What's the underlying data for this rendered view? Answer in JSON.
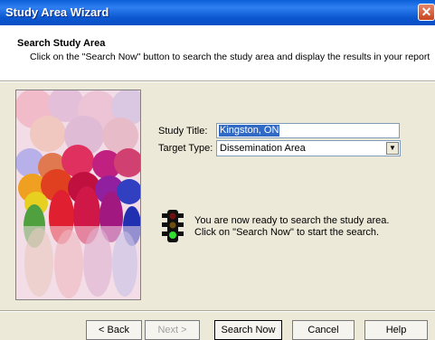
{
  "window": {
    "title": "Study Area Wizard",
    "close_glyph": "✕"
  },
  "header": {
    "title": "Search Study Area",
    "description": "Click on the \"Search Now\" button to search the study area and display the results in your report"
  },
  "form": {
    "study_title_label": "Study Title:",
    "study_title_value": "Kingston, ON",
    "target_type_label": "Target Type:",
    "target_type_value": "Dissemination Area"
  },
  "message": {
    "line1": "You are now ready to search the study area.",
    "line2": "Click on \"Search Now\" to start the search."
  },
  "buttons": {
    "back": "< Back",
    "next": "Next >",
    "search_now": "Search Now",
    "cancel": "Cancel",
    "help": "Help"
  },
  "icons": {
    "traffic_light": "traffic-light-icon",
    "dropdown": "chevron-down-icon",
    "wizard_image": "bubbles-illustration"
  }
}
